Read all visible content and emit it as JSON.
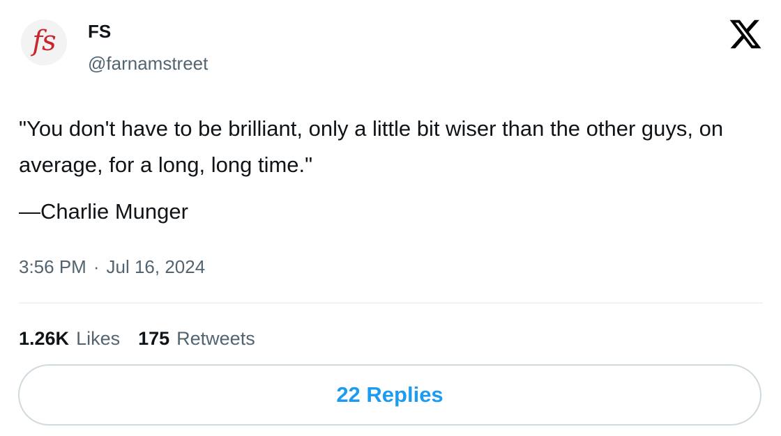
{
  "author": {
    "avatar_text": "fs",
    "display_name": "FS",
    "handle": "@farnamstreet"
  },
  "brand_icon": "x-logo-icon",
  "tweet": {
    "text": "\"You don't have to be brilliant, only a little bit wiser than the other guys, on average, for a long, long time.\"",
    "attribution": "—Charlie Munger",
    "time": "3:56 PM",
    "separator": "·",
    "date": "Jul 16, 2024"
  },
  "stats": {
    "likes_count": "1.26K",
    "likes_label": "Likes",
    "retweets_count": "175",
    "retweets_label": "Retweets"
  },
  "replies_button": {
    "label": "22 Replies"
  },
  "colors": {
    "text_primary": "#0f1419",
    "text_secondary": "#536471",
    "accent": "#1d9bf0",
    "logo_red": "#c8262d",
    "border": "#cfd9de"
  }
}
